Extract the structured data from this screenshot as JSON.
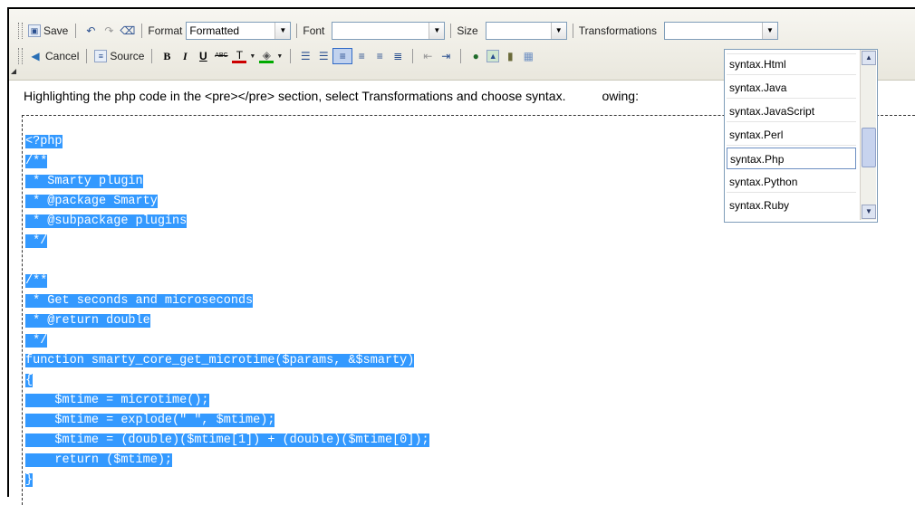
{
  "toolbar": {
    "row1": {
      "save": "Save",
      "format_label": "Format",
      "format_value": "Formatted",
      "font_label": "Font",
      "font_value": "",
      "size_label": "Size",
      "size_value": "",
      "transformations_label": "Transformations",
      "transformations_value": ""
    },
    "row2": {
      "cancel": "Cancel",
      "source": "Source",
      "bold": "B",
      "italic": "I",
      "underline": "U",
      "strike": "ABC"
    }
  },
  "instruction_text": "Highlighting the php code in the <pre></pre> section, select Transformations and choose syntax.",
  "instruction_tail": "owing:",
  "code_lines": [
    "<?php",
    "/**",
    " * Smarty plugin",
    " * @package Smarty",
    " * @subpackage plugins",
    " */",
    "",
    "/**",
    " * Get seconds and microseconds",
    " * @return double",
    " */",
    "function smarty_core_get_microtime($params, &$smarty)",
    "{",
    "    $mtime = microtime();",
    "    $mtime = explode(\" \", $mtime);",
    "    $mtime = (double)($mtime[1]) + (double)($mtime[0]);",
    "    return ($mtime);",
    "}"
  ],
  "dropdown": {
    "items": [
      "syntax.Html",
      "syntax.Java",
      "syntax.JavaScript",
      "syntax.Perl",
      "syntax.Php",
      "syntax.Python",
      "syntax.Ruby"
    ],
    "selected": "syntax.Php"
  },
  "colors": {
    "highlight": "#3399ff",
    "toolbar_bg": "#ece9d8"
  }
}
